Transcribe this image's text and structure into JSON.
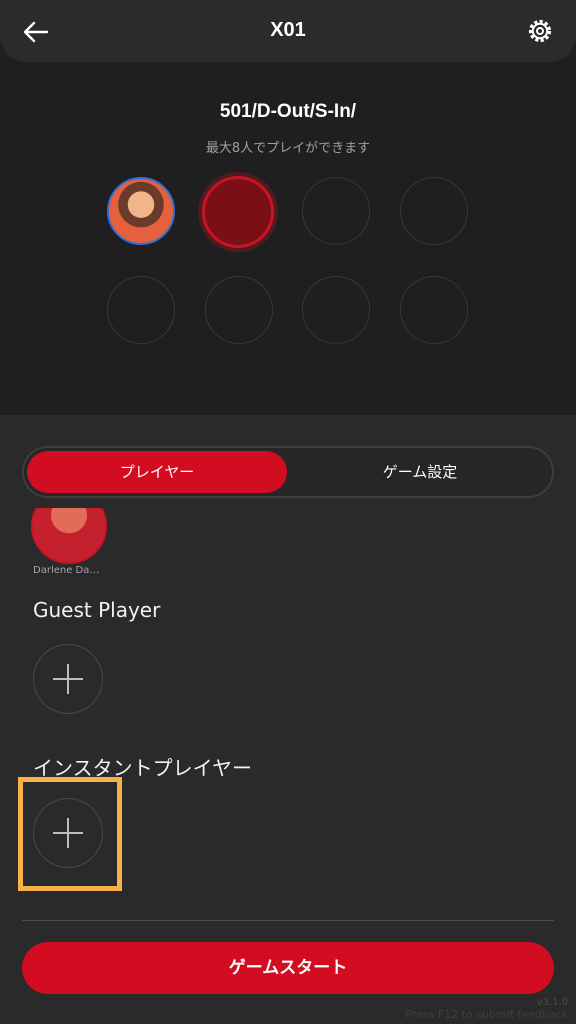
{
  "header": {
    "title": "X01",
    "back_icon": "arrow-left-icon",
    "settings_icon": "gear-icon"
  },
  "game": {
    "mode": "501/D-Out/S-In/",
    "subtitle": "最大8人でプレイができます"
  },
  "slots": [
    {
      "state": "avatar"
    },
    {
      "state": "selected"
    },
    {
      "state": "empty"
    },
    {
      "state": "empty"
    },
    {
      "state": "empty"
    },
    {
      "state": "empty"
    },
    {
      "state": "empty"
    },
    {
      "state": "empty"
    }
  ],
  "tabs": {
    "player": "プレイヤー",
    "settings": "ゲーム設定",
    "active": "player"
  },
  "registered_player": {
    "name": "Darlene Da…"
  },
  "guest": {
    "title": "Guest Player"
  },
  "instant": {
    "title": "インスタントプレイヤー"
  },
  "start_button": "ゲームスタート",
  "footer": {
    "version": "v3.1.0",
    "feedback": "Press F12 to submit feedback"
  },
  "colors": {
    "accent": "#d30d21",
    "highlight": "#f6b14c",
    "background": "#2a2a2a"
  }
}
